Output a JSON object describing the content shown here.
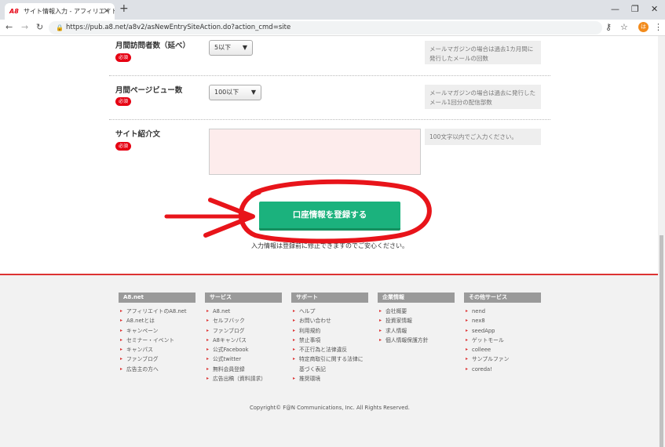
{
  "browser": {
    "tab_title": "サイト情報入力 - アフィリエイトのA8.net",
    "tab_logo": "A8",
    "url": "https://pub.a8.net/a8v2/asNewEntrySiteAction.do?action_cmd=site",
    "avatar_letter": "は"
  },
  "form": {
    "fields": [
      {
        "label": "月間訪問者数（延べ）",
        "required": "必須",
        "select_value": "5以下",
        "help": "メールマガジンの場合は過去1カ月間に発行したメールの回数"
      },
      {
        "label": "月間ページビュー数",
        "required": "必須",
        "select_value": "100以下",
        "help": "メールマガジンの場合は過去に発行したメール1回分の配信部数"
      },
      {
        "label": "サイト紹介文",
        "required": "必須",
        "help": "100文字以内でご入力ください。"
      }
    ],
    "submit_label": "口座情報を登録する",
    "note": "入力情報は登録前に修正できますのでご安心ください。"
  },
  "footer": {
    "columns": [
      {
        "title": "A8.net",
        "items": [
          "アフィリエイトのA8.net",
          "A8.netとは",
          "キャンペーン",
          "セミナー・イベント",
          "キャンパス",
          "ファンブログ",
          "広告主の方へ"
        ]
      },
      {
        "title": "サービス",
        "items": [
          "A8.net",
          "セルフバック",
          "ファンブログ",
          "A8キャンパス",
          "公式Facebook",
          "公式twitter",
          "無料会員登録",
          "広告出稿（資料請求）"
        ]
      },
      {
        "title": "サポート",
        "items": [
          "ヘルプ",
          "お問い合わせ",
          "利用規約",
          "禁止事項",
          "不正行為と法律違反",
          "特定商取引に関する法律に基づく表記",
          "推奨環境"
        ]
      },
      {
        "title": "企業情報",
        "items": [
          "会社概要",
          "投資家情報",
          "求人情報",
          "個人情報保護方針"
        ]
      },
      {
        "title": "その他サービス",
        "items": [
          "nend",
          "nex8",
          "seedApp",
          "ゲットモール",
          "colleee",
          "サンプルファン",
          "coreda!"
        ]
      }
    ],
    "copyright": "Copyright© F@N Communications, Inc. All Rights Reserved."
  },
  "colors": {
    "annotation_red": "#e8141a",
    "button_green": "#1bb27d",
    "required_red": "#e60012"
  }
}
